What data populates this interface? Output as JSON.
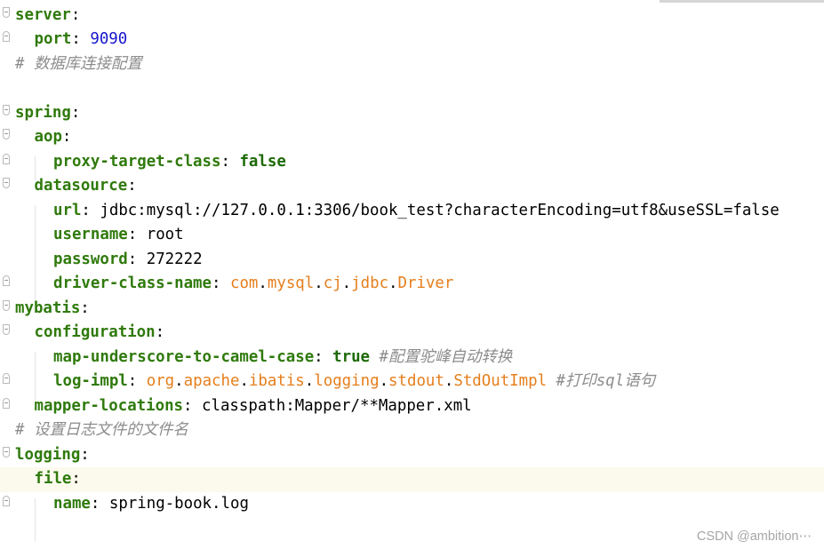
{
  "editor": {
    "language": "yaml",
    "current_line": 20,
    "lines": [
      {
        "num": 1,
        "indent": 0,
        "key": "server"
      },
      {
        "num": 2,
        "indent": 1,
        "key": "port",
        "number": "9090"
      },
      {
        "num": 3,
        "indent": 0,
        "comment": "# 数据库连接配置"
      },
      {
        "num": 4,
        "indent": 0
      },
      {
        "num": 5,
        "indent": 0,
        "key": "spring"
      },
      {
        "num": 6,
        "indent": 1,
        "key": "aop"
      },
      {
        "num": 7,
        "indent": 2,
        "key": "proxy-target-class",
        "bool": "false"
      },
      {
        "num": 8,
        "indent": 1,
        "key": "datasource"
      },
      {
        "num": 9,
        "indent": 2,
        "key": "url",
        "value": "jdbc:mysql://127.0.0.1:3306/book_test?characterEncoding=utf8&useSSL=false"
      },
      {
        "num": 10,
        "indent": 2,
        "key": "username",
        "value": "root"
      },
      {
        "num": 11,
        "indent": 2,
        "key": "password",
        "value": "272222"
      },
      {
        "num": 12,
        "indent": 2,
        "key": "driver-class-name",
        "parts": [
          "com",
          "mysql",
          "cj",
          "jdbc",
          "Driver"
        ]
      },
      {
        "num": 13,
        "indent": 0,
        "key": "mybatis"
      },
      {
        "num": 14,
        "indent": 1,
        "key": "configuration"
      },
      {
        "num": 15,
        "indent": 2,
        "key": "map-underscore-to-camel-case",
        "bool": "true",
        "comment": "#配置驼峰自动转换"
      },
      {
        "num": 16,
        "indent": 2,
        "key": "log-impl",
        "parts": [
          "org",
          "apache",
          "ibatis",
          "logging",
          "stdout",
          "StdOutImpl"
        ],
        "comment": "#打印sql语句"
      },
      {
        "num": 17,
        "indent": 1,
        "key": "mapper-locations",
        "value": "classpath:Mapper/**Mapper.xml"
      },
      {
        "num": 18,
        "indent": 0,
        "comment": "# 设置日志文件的文件名"
      },
      {
        "num": 19,
        "indent": 0,
        "key": "logging"
      },
      {
        "num": 20,
        "indent": 1,
        "key": "file"
      },
      {
        "num": 21,
        "indent": 2,
        "key": "name",
        "value": "spring-book.log"
      },
      {
        "num": 22,
        "indent": 0
      }
    ]
  },
  "watermark": "CSDN @ambition⋯",
  "colors": {
    "key": "#2f7a0c",
    "number": "#1515cc",
    "boolean": "#1d6a05",
    "class_ref": "#e57e1c",
    "comment": "#8c8c8c",
    "current_line_bg": "#fcfaed"
  }
}
